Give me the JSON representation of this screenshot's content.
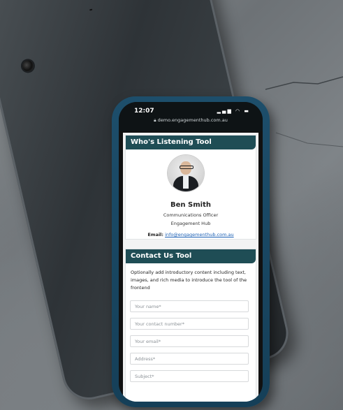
{
  "status": {
    "time": "12:07",
    "url": "demo.engagementhub.com.au"
  },
  "listening": {
    "title": "Who's Listening Tool",
    "name": "Ben Smith",
    "role": "Communications Officer",
    "org": "Engagement Hub",
    "email_label": "Email:",
    "email": "info@engagementhub.com.au"
  },
  "contact": {
    "title": "Contact Us Tool",
    "intro": "Optionally add introductory content including text, images, and rich media to introduce the tool of the frontend",
    "fields": {
      "name": "Your name*",
      "phone": "Your contact number*",
      "email": "Your email*",
      "address": "Address*",
      "subject": "Subject*"
    }
  },
  "colors": {
    "header": "#1f4d55",
    "phone_case": "#1d4e6b",
    "link": "#1a5fb4"
  }
}
